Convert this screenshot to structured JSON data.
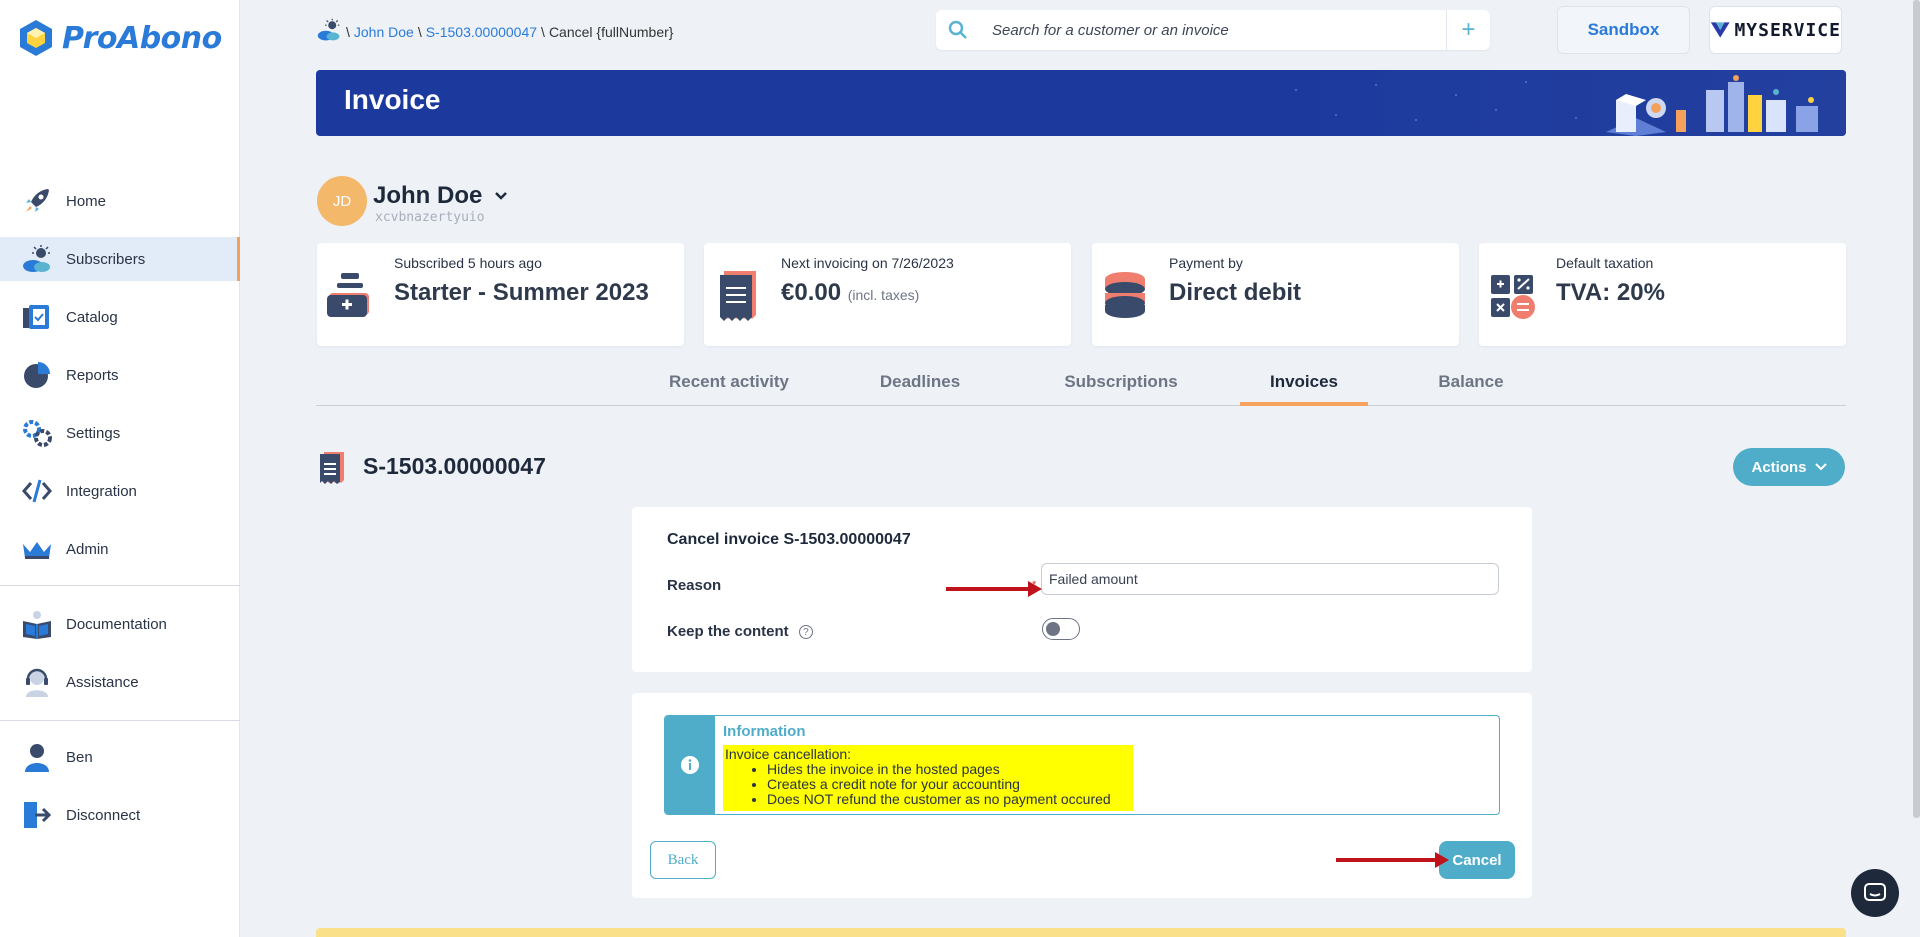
{
  "brand": {
    "name": "ProAbono"
  },
  "sidebar": {
    "items": [
      {
        "label": "Home",
        "icon": "rocket-icon"
      },
      {
        "label": "Subscribers",
        "icon": "subscribers-icon",
        "active": true
      },
      {
        "label": "Catalog",
        "icon": "catalog-icon"
      },
      {
        "label": "Reports",
        "icon": "pie-chart-icon"
      },
      {
        "label": "Settings",
        "icon": "gear-icon"
      },
      {
        "label": "Integration",
        "icon": "code-icon"
      },
      {
        "label": "Admin",
        "icon": "crown-icon"
      },
      {
        "label": "Documentation",
        "icon": "book-icon"
      },
      {
        "label": "Assistance",
        "icon": "headset-icon"
      },
      {
        "label": "Ben",
        "icon": "user-icon"
      },
      {
        "label": "Disconnect",
        "icon": "logout-icon"
      }
    ]
  },
  "breadcrumb": {
    "sep": "\\",
    "customer": "John Doe",
    "invoice": "S-1503.00000047",
    "current": "Cancel {fullNumber}"
  },
  "search": {
    "placeholder": "Search for a customer or an invoice",
    "add": "+"
  },
  "sandbox_label": "Sandbox",
  "myservice_label": "MYSERVICE",
  "banner": {
    "title": "Invoice"
  },
  "customer": {
    "initials": "JD",
    "name": "John Doe",
    "code": "xcvbnazertyuio"
  },
  "cards": [
    {
      "label": "Subscribed 5 hours ago",
      "value": "Starter - Summer 2023",
      "sub": "",
      "icon": "medical-kit-icon"
    },
    {
      "label": "Next invoicing on 7/26/2023",
      "value": "€0.00",
      "sub": "(incl. taxes)",
      "icon": "receipt-icon"
    },
    {
      "label": "Payment by",
      "value": "Direct debit",
      "sub": "",
      "icon": "coins-icon"
    },
    {
      "label": "Default taxation",
      "value": "TVA: 20%",
      "sub": "",
      "icon": "calculator-icon"
    }
  ],
  "tabs": [
    {
      "label": "Recent activity"
    },
    {
      "label": "Deadlines"
    },
    {
      "label": "Subscriptions"
    },
    {
      "label": "Invoices",
      "active": true
    },
    {
      "label": "Balance"
    }
  ],
  "invoice": {
    "number": "S-1503.00000047",
    "actions_label": "Actions"
  },
  "form": {
    "title": "Cancel invoice S-1503.00000047",
    "reason_label": "Reason",
    "reason_value": "Failed amount",
    "required_mark": "*",
    "keep_label": "Keep the content",
    "keep_value": false,
    "help_glyph": "?"
  },
  "info": {
    "title": "Information",
    "heading": "Invoice cancellation:",
    "bullets": [
      "Hides the invoice in the hosted pages",
      "Creates a credit note for your accounting",
      "Does NOT refund the customer as no payment occured"
    ]
  },
  "buttons": {
    "back": "Back",
    "cancel": "Cancel"
  },
  "colors": {
    "accent": "#4fadc9",
    "brand_blue": "#2a7ad8",
    "banner": "#1c3a9e",
    "highlight": "#ffff00",
    "arrow": "#c0121a",
    "active_tab": "#f3a15d"
  }
}
